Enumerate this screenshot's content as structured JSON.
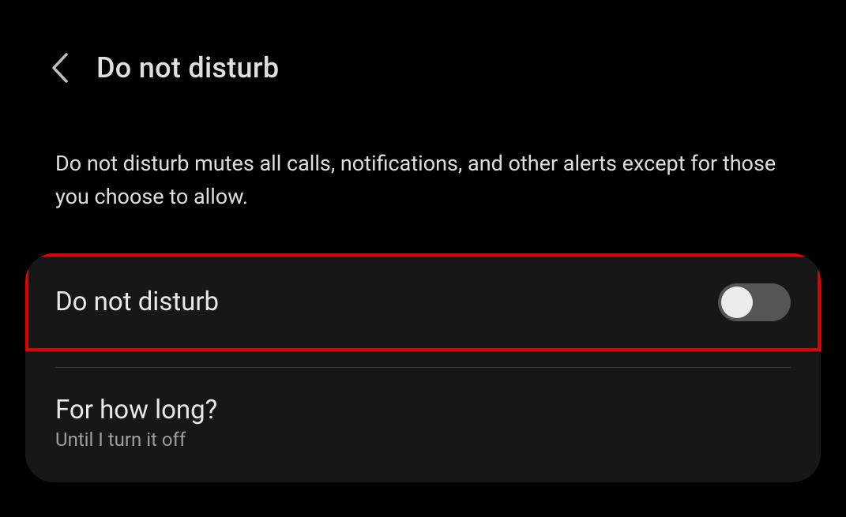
{
  "header": {
    "title": "Do not disturb"
  },
  "description": "Do not disturb mutes all calls, notifications, and other alerts except for those you choose to allow.",
  "settings": {
    "dnd_toggle": {
      "label": "Do not disturb",
      "state": "off"
    },
    "duration": {
      "label": "For how long?",
      "value": "Until I turn it off"
    }
  }
}
